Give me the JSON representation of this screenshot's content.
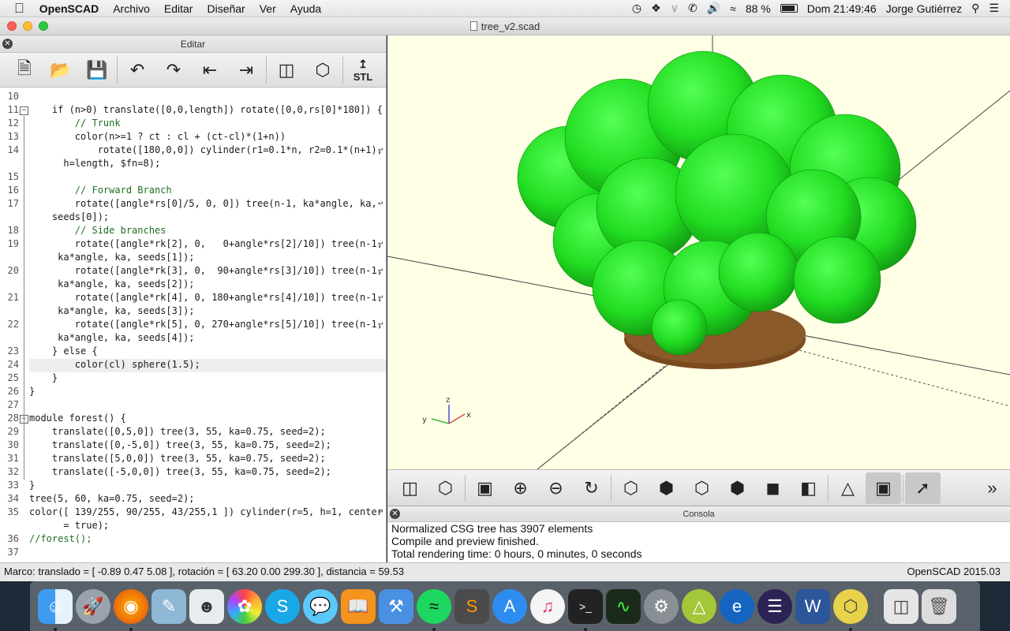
{
  "menubar": {
    "apple": "",
    "items": [
      "OpenSCAD",
      "Archivo",
      "Editar",
      "Diseñar",
      "Ver",
      "Ayuda"
    ],
    "battery": "88 %",
    "clock": "Dom 21:49:46",
    "user": "Jorge Gutiérrez"
  },
  "window": {
    "title": "tree_v2.scad"
  },
  "editor": {
    "header": "Editar",
    "stl_label": "STL"
  },
  "code": [
    {
      "n": "10",
      "t": ""
    },
    {
      "n": "11",
      "t": "    if (n>0) translate([0,0,length]) rotate([0,0,rs[0]*180]) {"
    },
    {
      "n": "12",
      "t": "        // Trunk"
    },
    {
      "n": "13",
      "t": "        color(n>=1 ? ct : cl + (ct-cl)*(1+n))"
    },
    {
      "n": "14",
      "t": "            rotate([180,0,0]) cylinder(r1=0.1*n, r2=0.1*(n+1),"
    },
    {
      "n": "",
      "t": "      h=length, $fn=8);"
    },
    {
      "n": "15",
      "t": ""
    },
    {
      "n": "16",
      "t": "        // Forward Branch"
    },
    {
      "n": "17",
      "t": "        rotate([angle*rs[0]/5, 0, 0]) tree(n-1, ka*angle, ka,"
    },
    {
      "n": "",
      "t": "    seeds[0]);"
    },
    {
      "n": "18",
      "t": "        // Side branches"
    },
    {
      "n": "19",
      "t": "        rotate([angle*rk[2], 0,   0+angle*rs[2]/10]) tree(n-1,"
    },
    {
      "n": "",
      "t": "     ka*angle, ka, seeds[1]);"
    },
    {
      "n": "20",
      "t": "        rotate([angle*rk[3], 0,  90+angle*rs[3]/10]) tree(n-1,"
    },
    {
      "n": "",
      "t": "     ka*angle, ka, seeds[2]);"
    },
    {
      "n": "21",
      "t": "        rotate([angle*rk[4], 0, 180+angle*rs[4]/10]) tree(n-1,"
    },
    {
      "n": "",
      "t": "     ka*angle, ka, seeds[3]);"
    },
    {
      "n": "22",
      "t": "        rotate([angle*rk[5], 0, 270+angle*rs[5]/10]) tree(n-1,"
    },
    {
      "n": "",
      "t": "     ka*angle, ka, seeds[4]);"
    },
    {
      "n": "23",
      "t": "    } else {"
    },
    {
      "n": "24",
      "t": "        color(cl) sphere(1.5);"
    },
    {
      "n": "25",
      "t": "    }"
    },
    {
      "n": "26",
      "t": "}"
    },
    {
      "n": "27",
      "t": ""
    },
    {
      "n": "28",
      "t": "module forest() {"
    },
    {
      "n": "29",
      "t": "    translate([0,5,0]) tree(3, 55, ka=0.75, seed=2);"
    },
    {
      "n": "30",
      "t": "    translate([0,-5,0]) tree(3, 55, ka=0.75, seed=2);"
    },
    {
      "n": "31",
      "t": "    translate([5,0,0]) tree(3, 55, ka=0.75, seed=2);"
    },
    {
      "n": "32",
      "t": "    translate([-5,0,0]) tree(3, 55, ka=0.75, seed=2);"
    },
    {
      "n": "33",
      "t": "}"
    },
    {
      "n": "34",
      "t": "tree(5, 60, ka=0.75, seed=2);"
    },
    {
      "n": "35",
      "t": "color([ 139/255, 90/255, 43/255,1 ]) cylinder(r=5, h=1, center"
    },
    {
      "n": "",
      "t": "      = true);"
    },
    {
      "n": "36",
      "t": "//forest();"
    },
    {
      "n": "37",
      "t": ""
    }
  ],
  "axis_labels": {
    "x": "x",
    "y": "y",
    "z": "z"
  },
  "console": {
    "header": "Consola",
    "lines": [
      "Normalized CSG tree has 3907 elements",
      "Compile and preview finished.",
      "Total rendering time: 0 hours, 0 minutes, 0 seconds"
    ]
  },
  "statusbar": {
    "left": "Marco: translado = [ -0.89 0.47 5.08 ], rotación = [ 63.20 0.00 299.30 ], distancia = 59.53",
    "right": "OpenSCAD 2015.03"
  },
  "colors": {
    "leaf": "#33dd33",
    "trunk": "#8b5a2b",
    "viewport_bg": "#ffffe6"
  }
}
